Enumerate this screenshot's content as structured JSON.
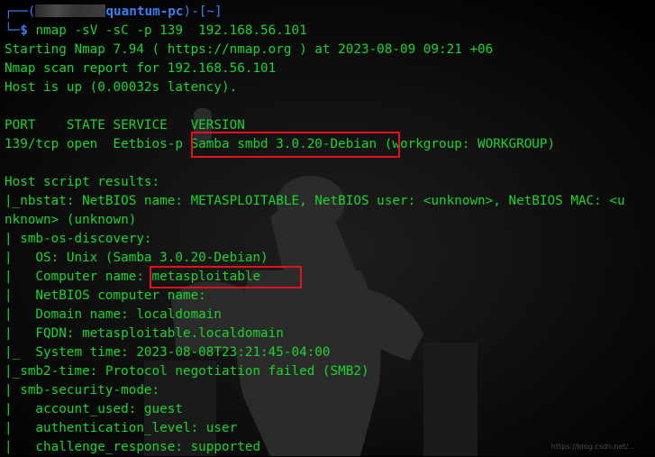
{
  "prompt": {
    "host": "quantum-pc",
    "dir": "[~]",
    "command": "nmap -sV -sC -p 139  192.168.56.101"
  },
  "output": [
    "Starting Nmap 7.94 ( https://nmap.org ) at 2023-08-09 09:21 +06",
    "Nmap scan report for 192.168.56.101",
    "Host is up (0.00032s latency).",
    "",
    "PORT    STATE SERVICE   VERSION",
    "139/tcp open  Eetbios-p Samba smbd 3.0.20-Debian (workgroup: WORKGROUP)",
    "",
    "Host script results:",
    "|_nbstat: NetBIOS name: METASPLOITABLE, NetBIOS user: <unknown>, NetBIOS MAC: <u",
    "nknown> (unknown)",
    "| smb-os-discovery:",
    "|   OS: Unix (Samba 3.0.20-Debian)",
    "|   Computer name: metasploitable",
    "|   NetBIOS computer name:",
    "|   Domain name: localdomain",
    "|   FQDN: metasploitable.localdomain",
    "|_  System time: 2023-08-08T23:21:45-04:00",
    "|_smb2-time: Protocol negotiation failed (SMB2)",
    "| smb-security-mode:",
    "|   account_used: guest",
    "|   authentication_level: user",
    "|   challenge_response: supported"
  ],
  "highlights": [
    {
      "text": "Samba smbd 3.0.20-Debian",
      "color": "#e3121c"
    },
    {
      "text": "metasploitable",
      "color": "#e3121c"
    }
  ],
  "colors": {
    "output_text": "#1bd42e",
    "prompt": "#3d7df2",
    "highlight_box": "#e3121c",
    "background": "#000000"
  },
  "watermark": "https://blog.csdn.net/..."
}
